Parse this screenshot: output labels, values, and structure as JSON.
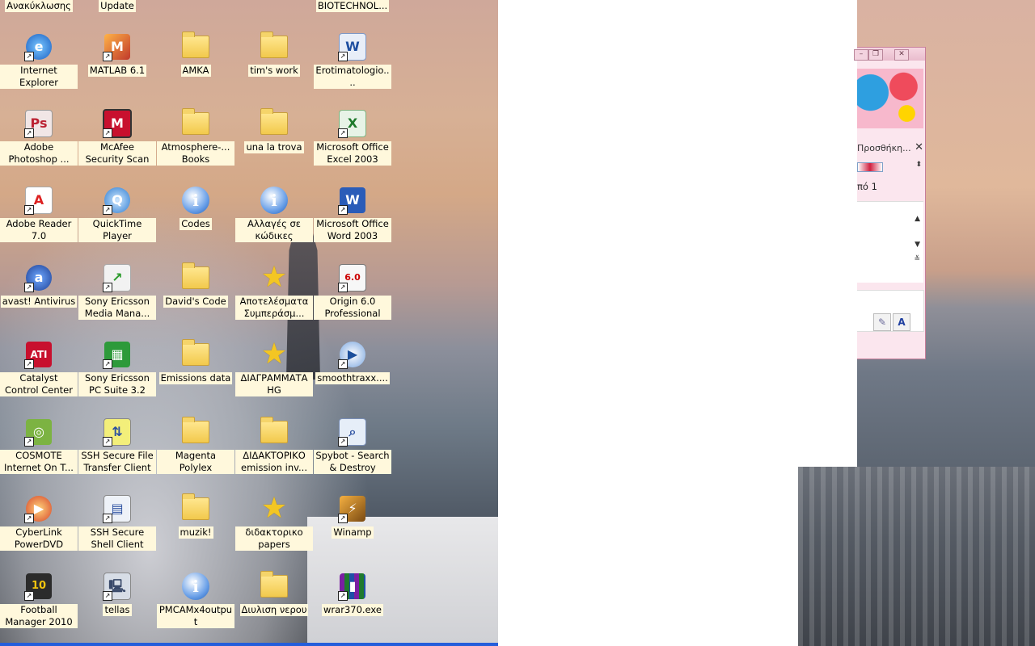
{
  "desktop": {
    "top_partial_labels": [
      "Ανακύκλωσης",
      "Update",
      "BIOTECHNOL..."
    ],
    "icons": [
      {
        "label": "Internet Explorer",
        "icon": "internet-explorer-icon"
      },
      {
        "label": "MATLAB 6.1",
        "icon": "matlab-icon"
      },
      {
        "label": "AMKA",
        "icon": "folder-icon"
      },
      {
        "label": "tim's work",
        "icon": "folder-icon"
      },
      {
        "label": "Erotimatologio....",
        "icon": "word-document-icon"
      },
      {
        "label": "Adobe Photoshop ...",
        "icon": "photoshop-icon"
      },
      {
        "label": "McAfee Security Scan",
        "icon": "mcafee-icon"
      },
      {
        "label": "Atmosphere-... Books",
        "icon": "folder-icon"
      },
      {
        "label": "una la trova",
        "icon": "folder-icon"
      },
      {
        "label": "Microsoft Office Excel 2003",
        "icon": "excel-icon"
      },
      {
        "label": "Adobe Reader 7.0",
        "icon": "adobe-reader-icon"
      },
      {
        "label": "QuickTime Player",
        "icon": "quicktime-icon"
      },
      {
        "label": "Codes",
        "icon": "info-icon"
      },
      {
        "label": "Αλλαγές σε κώδικες",
        "icon": "info-icon"
      },
      {
        "label": "Microsoft Office Word 2003",
        "icon": "word-icon"
      },
      {
        "label": "avast! Antivirus",
        "icon": "avast-icon"
      },
      {
        "label": "Sony Ericsson Media Mana...",
        "icon": "sony-ericsson-media-icon"
      },
      {
        "label": "David's Code",
        "icon": "folder-icon"
      },
      {
        "label": "Αποτελέσματα Συμπεράσμ...",
        "icon": "star-icon"
      },
      {
        "label": "Origin 6.0 Professional",
        "icon": "origin-icon"
      },
      {
        "label": "Catalyst Control Center",
        "icon": "ati-icon"
      },
      {
        "label": "Sony Ericsson PC Suite 3.2",
        "icon": "sony-ericsson-pc-suite-icon"
      },
      {
        "label": "Emissions data",
        "icon": "folder-icon"
      },
      {
        "label": "ΔΙΑΓΡΑΜΜΑΤΑ HG",
        "icon": "star-icon"
      },
      {
        "label": "smoothtraxx....",
        "icon": "media-player-icon"
      },
      {
        "label": "COSMOTE Internet On T...",
        "icon": "cosmote-icon"
      },
      {
        "label": "SSH Secure File Transfer Client",
        "icon": "ssh-file-transfer-icon"
      },
      {
        "label": "Magenta Polylex",
        "icon": "folder-icon"
      },
      {
        "label": "ΔΙΔΑΚΤΟΡΙΚΟ emission inv...",
        "icon": "folder-icon"
      },
      {
        "label": "Spybot - Search & Destroy",
        "icon": "spybot-icon"
      },
      {
        "label": "CyberLink PowerDVD",
        "icon": "powerdvd-icon"
      },
      {
        "label": "SSH Secure Shell Client",
        "icon": "ssh-shell-icon"
      },
      {
        "label": "muzik!",
        "icon": "folder-icon"
      },
      {
        "label": "διδακτορικο papers",
        "icon": "star-icon"
      },
      {
        "label": "Winamp",
        "icon": "winamp-icon"
      },
      {
        "label": "Football Manager 2010",
        "icon": "football-manager-icon"
      },
      {
        "label": "tellas",
        "icon": "network-computer-icon"
      },
      {
        "label": "PMCAMx4output",
        "icon": "info-icon"
      },
      {
        "label": "Διυλιση νερου",
        "icon": "folder-icon"
      },
      {
        "label": "wrar370.exe",
        "icon": "winrar-icon"
      }
    ]
  },
  "side_window": {
    "pane_title": "Προσθήκη...",
    "page_text": "πό 1",
    "close_glyph": "✕",
    "tool_letter": "A"
  }
}
